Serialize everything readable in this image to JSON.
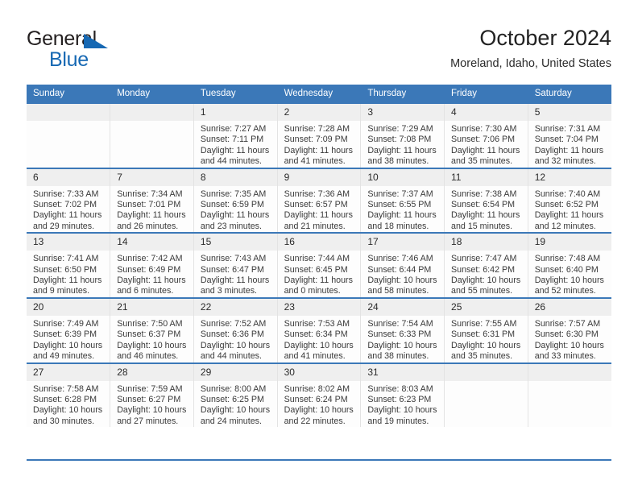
{
  "brand": {
    "name_part1": "General",
    "name_part2": "Blue"
  },
  "header": {
    "title": "October 2024",
    "location": "Moreland, Idaho, United States"
  },
  "colors": {
    "header_blue": "#3b78b8",
    "brand_blue": "#1668b3",
    "daynum_bg": "#efefef",
    "cell_bg": "#fdfdfd"
  },
  "weekdays": [
    "Sunday",
    "Monday",
    "Tuesday",
    "Wednesday",
    "Thursday",
    "Friday",
    "Saturday"
  ],
  "labels": {
    "sunrise_prefix": "Sunrise:",
    "sunset_prefix": "Sunset:",
    "daylight_prefix": "Daylight:"
  },
  "weeks": [
    [
      {
        "empty": true
      },
      {
        "empty": true
      },
      {
        "day": "1",
        "sunrise": "Sunrise: 7:27 AM",
        "sunset": "Sunset: 7:11 PM",
        "daylight": "Daylight: 11 hours and 44 minutes."
      },
      {
        "day": "2",
        "sunrise": "Sunrise: 7:28 AM",
        "sunset": "Sunset: 7:09 PM",
        "daylight": "Daylight: 11 hours and 41 minutes."
      },
      {
        "day": "3",
        "sunrise": "Sunrise: 7:29 AM",
        "sunset": "Sunset: 7:08 PM",
        "daylight": "Daylight: 11 hours and 38 minutes."
      },
      {
        "day": "4",
        "sunrise": "Sunrise: 7:30 AM",
        "sunset": "Sunset: 7:06 PM",
        "daylight": "Daylight: 11 hours and 35 minutes."
      },
      {
        "day": "5",
        "sunrise": "Sunrise: 7:31 AM",
        "sunset": "Sunset: 7:04 PM",
        "daylight": "Daylight: 11 hours and 32 minutes."
      }
    ],
    [
      {
        "day": "6",
        "sunrise": "Sunrise: 7:33 AM",
        "sunset": "Sunset: 7:02 PM",
        "daylight": "Daylight: 11 hours and 29 minutes."
      },
      {
        "day": "7",
        "sunrise": "Sunrise: 7:34 AM",
        "sunset": "Sunset: 7:01 PM",
        "daylight": "Daylight: 11 hours and 26 minutes."
      },
      {
        "day": "8",
        "sunrise": "Sunrise: 7:35 AM",
        "sunset": "Sunset: 6:59 PM",
        "daylight": "Daylight: 11 hours and 23 minutes."
      },
      {
        "day": "9",
        "sunrise": "Sunrise: 7:36 AM",
        "sunset": "Sunset: 6:57 PM",
        "daylight": "Daylight: 11 hours and 21 minutes."
      },
      {
        "day": "10",
        "sunrise": "Sunrise: 7:37 AM",
        "sunset": "Sunset: 6:55 PM",
        "daylight": "Daylight: 11 hours and 18 minutes."
      },
      {
        "day": "11",
        "sunrise": "Sunrise: 7:38 AM",
        "sunset": "Sunset: 6:54 PM",
        "daylight": "Daylight: 11 hours and 15 minutes."
      },
      {
        "day": "12",
        "sunrise": "Sunrise: 7:40 AM",
        "sunset": "Sunset: 6:52 PM",
        "daylight": "Daylight: 11 hours and 12 minutes."
      }
    ],
    [
      {
        "day": "13",
        "sunrise": "Sunrise: 7:41 AM",
        "sunset": "Sunset: 6:50 PM",
        "daylight": "Daylight: 11 hours and 9 minutes."
      },
      {
        "day": "14",
        "sunrise": "Sunrise: 7:42 AM",
        "sunset": "Sunset: 6:49 PM",
        "daylight": "Daylight: 11 hours and 6 minutes."
      },
      {
        "day": "15",
        "sunrise": "Sunrise: 7:43 AM",
        "sunset": "Sunset: 6:47 PM",
        "daylight": "Daylight: 11 hours and 3 minutes."
      },
      {
        "day": "16",
        "sunrise": "Sunrise: 7:44 AM",
        "sunset": "Sunset: 6:45 PM",
        "daylight": "Daylight: 11 hours and 0 minutes."
      },
      {
        "day": "17",
        "sunrise": "Sunrise: 7:46 AM",
        "sunset": "Sunset: 6:44 PM",
        "daylight": "Daylight: 10 hours and 58 minutes."
      },
      {
        "day": "18",
        "sunrise": "Sunrise: 7:47 AM",
        "sunset": "Sunset: 6:42 PM",
        "daylight": "Daylight: 10 hours and 55 minutes."
      },
      {
        "day": "19",
        "sunrise": "Sunrise: 7:48 AM",
        "sunset": "Sunset: 6:40 PM",
        "daylight": "Daylight: 10 hours and 52 minutes."
      }
    ],
    [
      {
        "day": "20",
        "sunrise": "Sunrise: 7:49 AM",
        "sunset": "Sunset: 6:39 PM",
        "daylight": "Daylight: 10 hours and 49 minutes."
      },
      {
        "day": "21",
        "sunrise": "Sunrise: 7:50 AM",
        "sunset": "Sunset: 6:37 PM",
        "daylight": "Daylight: 10 hours and 46 minutes."
      },
      {
        "day": "22",
        "sunrise": "Sunrise: 7:52 AM",
        "sunset": "Sunset: 6:36 PM",
        "daylight": "Daylight: 10 hours and 44 minutes."
      },
      {
        "day": "23",
        "sunrise": "Sunrise: 7:53 AM",
        "sunset": "Sunset: 6:34 PM",
        "daylight": "Daylight: 10 hours and 41 minutes."
      },
      {
        "day": "24",
        "sunrise": "Sunrise: 7:54 AM",
        "sunset": "Sunset: 6:33 PM",
        "daylight": "Daylight: 10 hours and 38 minutes."
      },
      {
        "day": "25",
        "sunrise": "Sunrise: 7:55 AM",
        "sunset": "Sunset: 6:31 PM",
        "daylight": "Daylight: 10 hours and 35 minutes."
      },
      {
        "day": "26",
        "sunrise": "Sunrise: 7:57 AM",
        "sunset": "Sunset: 6:30 PM",
        "daylight": "Daylight: 10 hours and 33 minutes."
      }
    ],
    [
      {
        "day": "27",
        "sunrise": "Sunrise: 7:58 AM",
        "sunset": "Sunset: 6:28 PM",
        "daylight": "Daylight: 10 hours and 30 minutes."
      },
      {
        "day": "28",
        "sunrise": "Sunrise: 7:59 AM",
        "sunset": "Sunset: 6:27 PM",
        "daylight": "Daylight: 10 hours and 27 minutes."
      },
      {
        "day": "29",
        "sunrise": "Sunrise: 8:00 AM",
        "sunset": "Sunset: 6:25 PM",
        "daylight": "Daylight: 10 hours and 24 minutes."
      },
      {
        "day": "30",
        "sunrise": "Sunrise: 8:02 AM",
        "sunset": "Sunset: 6:24 PM",
        "daylight": "Daylight: 10 hours and 22 minutes."
      },
      {
        "day": "31",
        "sunrise": "Sunrise: 8:03 AM",
        "sunset": "Sunset: 6:23 PM",
        "daylight": "Daylight: 10 hours and 19 minutes."
      },
      {
        "empty": true
      },
      {
        "empty": true
      }
    ]
  ]
}
